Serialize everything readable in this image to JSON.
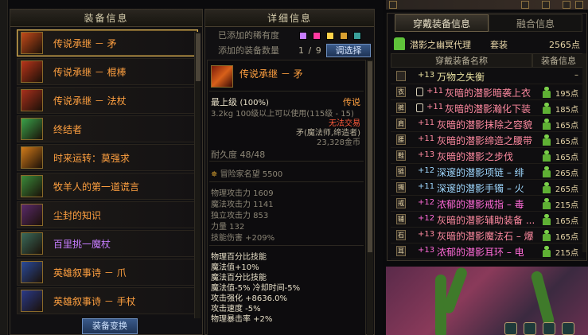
{
  "left": {
    "title": "装备信息",
    "items": [
      {
        "name": "传说承继 － 矛",
        "color": "#ffa040",
        "icon_color": "#c24a1a"
      },
      {
        "name": "传说承继 － 棍棒",
        "color": "#ffa040",
        "icon_color": "#b8341a"
      },
      {
        "name": "传说承继 － 法杖",
        "color": "#ffa040",
        "icon_color": "#a8301c"
      },
      {
        "name": "终结者",
        "color": "#ffa040",
        "icon_color": "#3aa24a"
      },
      {
        "name": "时来运转：莫强求",
        "color": "#ffa040",
        "icon_color": "#d07a1a"
      },
      {
        "name": "牧羊人的第一道谎言",
        "color": "#ffa040",
        "icon_color": "#3a8a3a"
      },
      {
        "name": "尘封的知识",
        "color": "#ffa040",
        "icon_color": "#5a2a6a"
      },
      {
        "name": "百里挑一魔杖",
        "color": "#c77dff",
        "icon_color": "#3a6a5a"
      },
      {
        "name": "英雄叙事诗 － 爪",
        "color": "#ffa040",
        "icon_color": "#2a4a9a"
      },
      {
        "name": "英雄叙事诗 － 手杖",
        "color": "#ffa040",
        "icon_color": "#2a3a8a"
      }
    ],
    "swap_button": "装备变换"
  },
  "middle": {
    "title": "详细信息",
    "rarity_label": "已添加的稀有度",
    "count_label": "添加的装备数量",
    "count_value": "1 / 9",
    "add_button": "调选择",
    "swatches": [
      "#c77dff",
      "#ff3aa0",
      "#ffd24a",
      "#d8a030",
      "#3aa09a"
    ],
    "detail": {
      "name": "传说承继 － 矛",
      "grade": "最上级",
      "grade_pct": "(100%)",
      "rarity": "传说",
      "weight_req": "3.2kg  100级以上可以使用(115级 - 15)",
      "trade": "无法交易",
      "class": "矛(魔法师,缔造者)",
      "price": "23,328金币",
      "durability": "耐久度 48/48",
      "adventurer": "冒险家名望 5500",
      "stats": [
        "物理攻击力 1609",
        "魔法攻击力 1141",
        "独立攻击力 853",
        "力量 132",
        "技能伤害 +209%"
      ],
      "effects": [
        "物理百分比技能",
        " 魔法值+10%",
        "魔法百分比技能",
        " 魔法值-5% 冷却时间-5%",
        "攻击强化 +8636.0%",
        "攻击速度 -5%",
        "物理暴击率 +2%"
      ]
    }
  },
  "right": {
    "tabs": [
      "穿戴装备信息",
      "融合信息"
    ],
    "set_name": "潜影之幽冥代理",
    "set_kind": "套装",
    "set_points": "2565点",
    "col_name": "穿戴装备名称",
    "col_info": "装备信息",
    "rows": [
      {
        "icon": "",
        "lock": false,
        "enh": "+13",
        "enh_color": "#e8e0a0",
        "name": "万物之失衡",
        "name_color": "#e8e0a0",
        "status": false,
        "points": "–"
      },
      {
        "icon": "衣",
        "lock": true,
        "enh": "+11",
        "enh_color": "#ff8aa0",
        "name": "灰暗的潜影暗袭上衣",
        "name_color": "#ff8aa0",
        "status": true,
        "points": "195点"
      },
      {
        "icon": "裤",
        "lock": true,
        "enh": "+11",
        "enh_color": "#ff8aa0",
        "name": "灰暗的潜影瀚化下装",
        "name_color": "#ff8aa0",
        "status": true,
        "points": "185点"
      },
      {
        "icon": "肩",
        "lock": false,
        "enh": "+11",
        "enh_color": "#ff8aa0",
        "name": "灰暗的潜影抹除之容貌",
        "name_color": "#ff8aa0",
        "status": true,
        "points": "165点"
      },
      {
        "icon": "腰",
        "lock": false,
        "enh": "+11",
        "enh_color": "#ff8aa0",
        "name": "灰暗的潜影缔造之腰带",
        "name_color": "#ff8aa0",
        "status": true,
        "points": "165点"
      },
      {
        "icon": "鞋",
        "lock": false,
        "enh": "+13",
        "enh_color": "#ff8aa0",
        "name": "灰暗的潜影之步伐",
        "name_color": "#ff8aa0",
        "status": true,
        "points": "165点"
      },
      {
        "icon": "链",
        "lock": false,
        "enh": "+12",
        "enh_color": "#9fd8ff",
        "name": "深邃的潜影项链 – 绯",
        "name_color": "#9fd8ff",
        "status": true,
        "points": "265点"
      },
      {
        "icon": "镯",
        "lock": false,
        "enh": "+11",
        "enh_color": "#9fd8ff",
        "name": "深邃的潜影手镯 – 火",
        "name_color": "#9fd8ff",
        "status": true,
        "points": "265点"
      },
      {
        "icon": "戒",
        "lock": false,
        "enh": "+12",
        "enh_color": "#ff6ad8",
        "name": "浓郁的潜影戒指 – 毒",
        "name_color": "#ff6ad8",
        "status": true,
        "points": "215点"
      },
      {
        "icon": "辅",
        "lock": false,
        "enh": "+12",
        "enh_color": "#ff6ad8",
        "name": "灰暗的潜影辅助装备 ...",
        "name_color": "#ff8aa0",
        "status": true,
        "points": "165点"
      },
      {
        "icon": "石",
        "lock": false,
        "enh": "+13",
        "enh_color": "#ff8aa0",
        "name": "灰暗的潜影魔法石 – 爆",
        "name_color": "#ff8aa0",
        "status": true,
        "points": "165点"
      },
      {
        "icon": "耳",
        "lock": false,
        "enh": "+13",
        "enh_color": "#ff6ad8",
        "name": "浓郁的潜影耳环 – 电",
        "name_color": "#ff6ad8",
        "status": true,
        "points": "215点"
      }
    ]
  }
}
